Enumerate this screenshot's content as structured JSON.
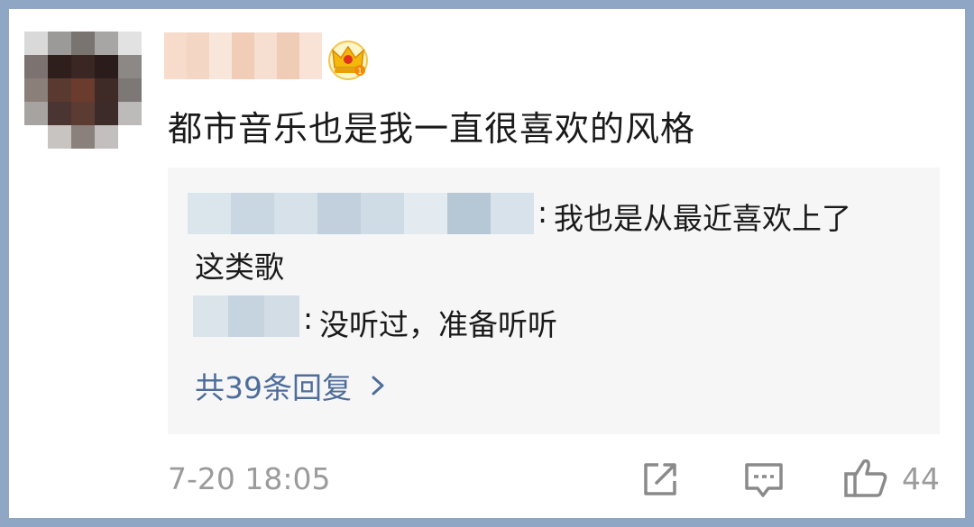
{
  "comment": {
    "text": "都市音乐也是我一直很喜欢的风格",
    "timestamp": "7-20 18:05",
    "like_count": "44"
  },
  "author": {
    "badge_icon": "crown-badge-icon",
    "badge_color": "#f5b80a"
  },
  "replies": [
    {
      "separator": ":",
      "text_line1": "我也是从最近喜欢上了",
      "text_line2": "这类歌"
    },
    {
      "separator": ":",
      "text": "没听过，准备听听"
    }
  ],
  "more_replies": {
    "label": "共39条回复",
    "icon": "chevron-right-icon"
  },
  "actions": {
    "share_icon": "share-icon",
    "comment_icon": "comment-icon",
    "like_icon": "thumbs-up-icon"
  },
  "colors": {
    "link": "#4e6d9b",
    "meta_gray": "#9b9b9b",
    "reply_background": "#f6f6f6",
    "border": "#8fa6c4"
  }
}
